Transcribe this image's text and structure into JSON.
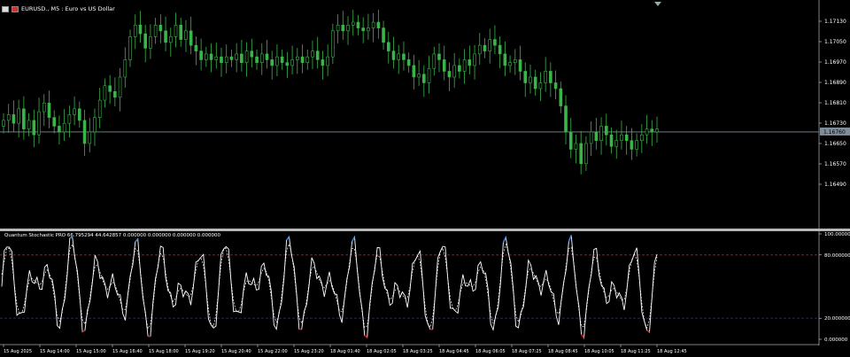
{
  "window": {
    "symbol_title": "EURUSD., M5 : Euro vs US Dollar",
    "icon_flag_1": "flag-icon",
    "icon_flag_2": "flag-icon"
  },
  "colors": {
    "background": "#000000",
    "candle_bull": "#3ab54a",
    "candle_bear": "#3ab54a",
    "price_line": "#7f8c99",
    "axis_text": "#ffffff",
    "stoch_main": "#ffffff",
    "stoch_signal": "#ffffff",
    "stoch_high": "#3d7fe0",
    "stoch_low": "#e0191e",
    "level_80": "#b0201e",
    "level_20": "#1f2aa8"
  },
  "price_axis": {
    "labels": [
      "1.17130",
      "1.17050",
      "1.16970",
      "1.16890",
      "1.16810",
      "1.16730",
      "1.16650",
      "1.16570",
      "1.16490"
    ],
    "display_labels": [
      "1.17130",
      "1.17050",
      "1.16970",
      "1.16890",
      "1.16810",
      "1.16730",
      "1.16650",
      "1.16570",
      "1.16490"
    ]
  },
  "price_tag": "1.16760",
  "indicator": {
    "title": "Quantum Stochastic PRO 66.795294 44.642857 0.000000 0.000000 0.000000 0.000000",
    "axis_labels": [
      "100.000000",
      "80.000000",
      "20.000000",
      "0.000000"
    ]
  },
  "time_axis": {
    "labels": [
      "15 Aug 2025",
      "15 Aug 14:00",
      "15 Aug 15:00",
      "15 Aug 16:40",
      "15 Aug 18:00",
      "15 Aug 19:20",
      "15 Aug 20:40",
      "15 Aug 22:00",
      "15 Aug 23:20",
      "18 Aug 01:40",
      "18 Aug 02:05",
      "18 Aug 03:25",
      "18 Aug 04:45",
      "18 Aug 06:05",
      "18 Aug 07:25",
      "18 Aug 08:45",
      "18 Aug 10:05",
      "18 Aug 11:25",
      "18 Aug 12:45"
    ]
  },
  "chart_data": {
    "type": "candlestick",
    "symbol": "EURUSD.",
    "timeframe": "M5",
    "y_range": [
      1.1645,
      1.1718
    ],
    "current_price": 1.1676,
    "close_series": [
      1.168,
      1.1682,
      1.1679,
      1.1684,
      1.1677,
      1.168,
      1.1675,
      1.1683,
      1.1686,
      1.1681,
      1.1678,
      1.1676,
      1.1679,
      1.1682,
      1.1684,
      1.168,
      1.1672,
      1.1676,
      1.1681,
      1.1687,
      1.1692,
      1.169,
      1.1688,
      1.1695,
      1.1701,
      1.1709,
      1.1713,
      1.171,
      1.1705,
      1.1709,
      1.1713,
      1.1711,
      1.1707,
      1.1709,
      1.1713,
      1.1708,
      1.1711,
      1.1706,
      1.1704,
      1.1701,
      1.1703,
      1.1701,
      1.1702,
      1.17,
      1.1702,
      1.1701,
      1.1703,
      1.17,
      1.1704,
      1.1702,
      1.17,
      1.1703,
      1.1701,
      1.1699,
      1.1702,
      1.17,
      1.1699,
      1.1701,
      1.1702,
      1.17,
      1.1702,
      1.1704,
      1.1701,
      1.1699,
      1.1702,
      1.1711,
      1.1713,
      1.1711,
      1.1713,
      1.1714,
      1.1712,
      1.1711,
      1.1712,
      1.1714,
      1.1712,
      1.1707,
      1.1704,
      1.1701,
      1.1703,
      1.1701,
      1.1699,
      1.1695,
      1.1696,
      1.1693,
      1.1698,
      1.1703,
      1.1701,
      1.1697,
      1.1695,
      1.1699,
      1.1697,
      1.1701,
      1.1699,
      1.1703,
      1.1706,
      1.1704,
      1.1708,
      1.1706,
      1.1703,
      1.1699,
      1.17,
      1.1701,
      1.1697,
      1.1693,
      1.1695,
      1.1691,
      1.1693,
      1.1697,
      1.1693,
      1.1691,
      1.1685,
      1.1676,
      1.167,
      1.1672,
      1.1665,
      1.1672,
      1.1676,
      1.1673,
      1.1678,
      1.1675,
      1.1671,
      1.1673,
      1.1675,
      1.1673,
      1.167,
      1.1673,
      1.1675,
      1.1677,
      1.1676,
      1.1677
    ]
  }
}
